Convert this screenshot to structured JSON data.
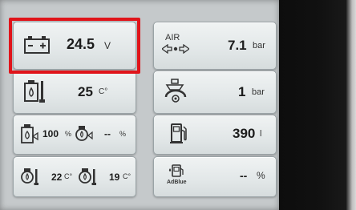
{
  "battery": {
    "value": "24.5",
    "unit": "V",
    "icon": "battery-icon"
  },
  "air": {
    "label": "AIR",
    "value": "7.1",
    "unit": "bar",
    "icon": "air-pressure-icon"
  },
  "coolant": {
    "value": "25",
    "unit": "C°",
    "icon": "coolant-temperature-icon"
  },
  "oil_pressure": {
    "value": "1",
    "unit": "bar",
    "icon": "oil-pressure-icon"
  },
  "tanks": {
    "left_value": "100",
    "left_unit": "%",
    "right_value": "--",
    "right_unit": "%"
  },
  "fuel": {
    "value": "390",
    "unit": "l",
    "icon": "fuel-pump-icon"
  },
  "temps": {
    "left_value": "22",
    "left_unit": "C°",
    "right_value": "19",
    "right_unit": "C°"
  },
  "adblue": {
    "label": "AdBlue",
    "value": "--",
    "unit": "%",
    "icon": "adblue-icon"
  },
  "colors": {
    "highlight": "#e0141a",
    "tile": "#e6eaeb",
    "screen": "#c5c9cb"
  }
}
